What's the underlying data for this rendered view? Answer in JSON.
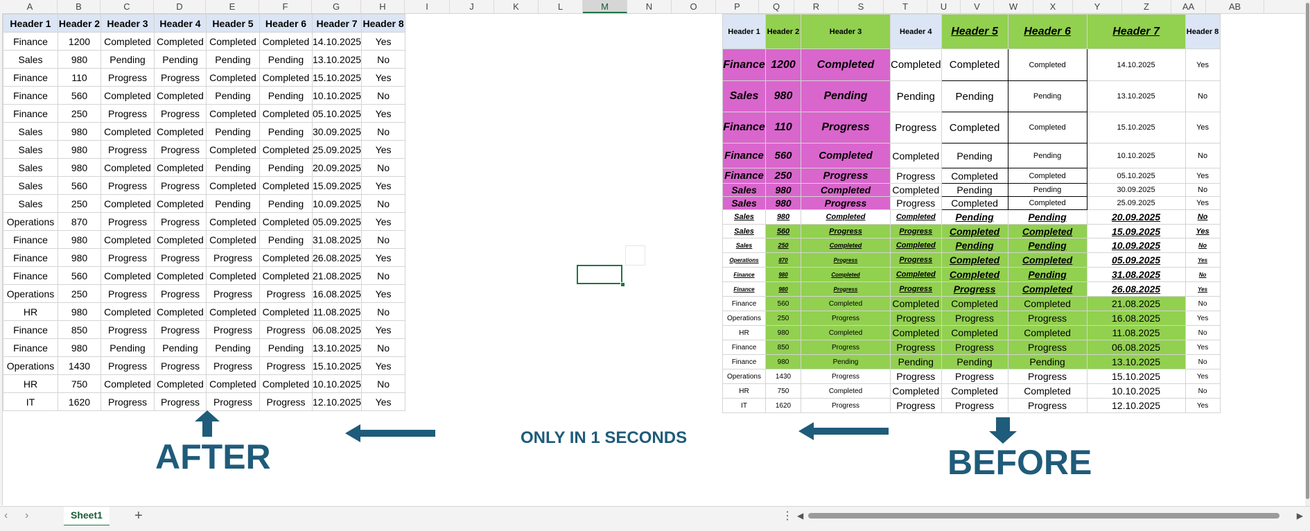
{
  "columns": [
    "A",
    "B",
    "C",
    "D",
    "E",
    "F",
    "G",
    "H",
    "I",
    "J",
    "K",
    "L",
    "M",
    "N",
    "O",
    "P",
    "Q",
    "R",
    "S",
    "T",
    "U",
    "V",
    "W",
    "X",
    "Y",
    "Z",
    "AA",
    "AB"
  ],
  "selected_column": "M",
  "after_table": {
    "headers": [
      "Header 1",
      "Header 2",
      "Header 3",
      "Header 4",
      "Header 5",
      "Header 6",
      "Header 7",
      "Header 8"
    ],
    "rows": [
      [
        "Finance",
        "1200",
        "Completed",
        "Completed",
        "Completed",
        "Completed",
        "14.10.2025",
        "Yes"
      ],
      [
        "Sales",
        "980",
        "Pending",
        "Pending",
        "Pending",
        "Pending",
        "13.10.2025",
        "No"
      ],
      [
        "Finance",
        "110",
        "Progress",
        "Progress",
        "Completed",
        "Completed",
        "15.10.2025",
        "Yes"
      ],
      [
        "Finance",
        "560",
        "Completed",
        "Completed",
        "Pending",
        "Pending",
        "10.10.2025",
        "No"
      ],
      [
        "Finance",
        "250",
        "Progress",
        "Progress",
        "Completed",
        "Completed",
        "05.10.2025",
        "Yes"
      ],
      [
        "Sales",
        "980",
        "Completed",
        "Completed",
        "Pending",
        "Pending",
        "30.09.2025",
        "No"
      ],
      [
        "Sales",
        "980",
        "Progress",
        "Progress",
        "Completed",
        "Completed",
        "25.09.2025",
        "Yes"
      ],
      [
        "Sales",
        "980",
        "Completed",
        "Completed",
        "Pending",
        "Pending",
        "20.09.2025",
        "No"
      ],
      [
        "Sales",
        "560",
        "Progress",
        "Progress",
        "Completed",
        "Completed",
        "15.09.2025",
        "Yes"
      ],
      [
        "Sales",
        "250",
        "Completed",
        "Completed",
        "Pending",
        "Pending",
        "10.09.2025",
        "No"
      ],
      [
        "Operations",
        "870",
        "Progress",
        "Progress",
        "Completed",
        "Completed",
        "05.09.2025",
        "Yes"
      ],
      [
        "Finance",
        "980",
        "Completed",
        "Completed",
        "Completed",
        "Pending",
        "31.08.2025",
        "No"
      ],
      [
        "Finance",
        "980",
        "Progress",
        "Progress",
        "Progress",
        "Completed",
        "26.08.2025",
        "Yes"
      ],
      [
        "Finance",
        "560",
        "Completed",
        "Completed",
        "Completed",
        "Completed",
        "21.08.2025",
        "No"
      ],
      [
        "Operations",
        "250",
        "Progress",
        "Progress",
        "Progress",
        "Progress",
        "16.08.2025",
        "Yes"
      ],
      [
        "HR",
        "980",
        "Completed",
        "Completed",
        "Completed",
        "Completed",
        "11.08.2025",
        "No"
      ],
      [
        "Finance",
        "850",
        "Progress",
        "Progress",
        "Progress",
        "Progress",
        "06.08.2025",
        "Yes"
      ],
      [
        "Finance",
        "980",
        "Pending",
        "Pending",
        "Pending",
        "Pending",
        "13.10.2025",
        "No"
      ],
      [
        "Operations",
        "1430",
        "Progress",
        "Progress",
        "Progress",
        "Progress",
        "15.10.2025",
        "Yes"
      ],
      [
        "HR",
        "750",
        "Completed",
        "Completed",
        "Completed",
        "Completed",
        "10.10.2025",
        "No"
      ],
      [
        "IT",
        "1620",
        "Progress",
        "Progress",
        "Progress",
        "Progress",
        "12.10.2025",
        "Yes"
      ]
    ]
  },
  "before_table": {
    "headers": [
      "Header 1",
      "Header 2",
      "Header 3",
      "Header 4",
      "Header 5",
      "Header 6",
      "Header 7",
      "Header 8"
    ],
    "rows": [
      [
        "Finance",
        "1200",
        "Completed",
        "Completed",
        "Completed",
        "Completed",
        "14.10.2025",
        "Yes"
      ],
      [
        "Sales",
        "980",
        "Pending",
        "Pending",
        "Pending",
        "Pending",
        "13.10.2025",
        "No"
      ],
      [
        "Finance",
        "110",
        "Progress",
        "Progress",
        "Completed",
        "Completed",
        "15.10.2025",
        "Yes"
      ],
      [
        "Finance",
        "560",
        "Completed",
        "Completed",
        "Pending",
        "Pending",
        "10.10.2025",
        "No"
      ],
      [
        "Finance",
        "250",
        "Progress",
        "Progress",
        "Completed",
        "Completed",
        "05.10.2025",
        "Yes"
      ],
      [
        "Sales",
        "980",
        "Completed",
        "Completed",
        "Pending",
        "Pending",
        "30.09.2025",
        "No"
      ],
      [
        "Sales",
        "980",
        "Progress",
        "Progress",
        "Completed",
        "Completed",
        "25.09.2025",
        "Yes"
      ],
      [
        "Sales",
        "980",
        "Completed",
        "Completed",
        "Pending",
        "Pending",
        "20.09.2025",
        "No"
      ],
      [
        "Sales",
        "560",
        "Progress",
        "Progress",
        "Completed",
        "Completed",
        "15.09.2025",
        "Yes"
      ],
      [
        "Sales",
        "250",
        "Completed",
        "Completed",
        "Pending",
        "Pending",
        "10.09.2025",
        "No"
      ],
      [
        "Operations",
        "870",
        "Progress",
        "Progress",
        "Completed",
        "Completed",
        "05.09.2025",
        "Yes"
      ],
      [
        "Finance",
        "980",
        "Completed",
        "Completed",
        "Completed",
        "Pending",
        "31.08.2025",
        "No"
      ],
      [
        "Finance",
        "980",
        "Progress",
        "Progress",
        "Progress",
        "Completed",
        "26.08.2025",
        "Yes"
      ],
      [
        "Finance",
        "560",
        "Completed",
        "Completed",
        "Completed",
        "Completed",
        "21.08.2025",
        "No"
      ],
      [
        "Operations",
        "250",
        "Progress",
        "Progress",
        "Progress",
        "Progress",
        "16.08.2025",
        "Yes"
      ],
      [
        "HR",
        "980",
        "Completed",
        "Completed",
        "Completed",
        "Completed",
        "11.08.2025",
        "No"
      ],
      [
        "Finance",
        "850",
        "Progress",
        "Progress",
        "Progress",
        "Progress",
        "06.08.2025",
        "Yes"
      ],
      [
        "Finance",
        "980",
        "Pending",
        "Pending",
        "Pending",
        "Pending",
        "13.10.2025",
        "No"
      ],
      [
        "Operations",
        "1430",
        "Progress",
        "Progress",
        "Progress",
        "Progress",
        "15.10.2025",
        "Yes"
      ],
      [
        "HR",
        "750",
        "Completed",
        "Completed",
        "Completed",
        "Completed",
        "10.10.2025",
        "No"
      ],
      [
        "IT",
        "1620",
        "Progress",
        "Progress",
        "Progress",
        "Progress",
        "12.10.2025",
        "Yes"
      ]
    ]
  },
  "labels": {
    "after": "AFTER",
    "before": "BEFORE",
    "only": "ONLY IN 1 SECONDS"
  },
  "tabs": {
    "sheet1": "Sheet1",
    "add": "+",
    "prev": "‹",
    "next": "›",
    "more": "⋮"
  },
  "colors": {
    "header_fill": "#dbe5f5",
    "green_fill": "#92d050",
    "pink_fill": "#d966cc",
    "label_color": "#1f5b7a",
    "selection_green": "#217346"
  },
  "icons": [
    "arrow-up-icon",
    "arrow-down-icon",
    "arrow-left-icon",
    "add-sheet-icon",
    "scroll-left-icon",
    "scroll-right-icon",
    "more-options-icon"
  ]
}
